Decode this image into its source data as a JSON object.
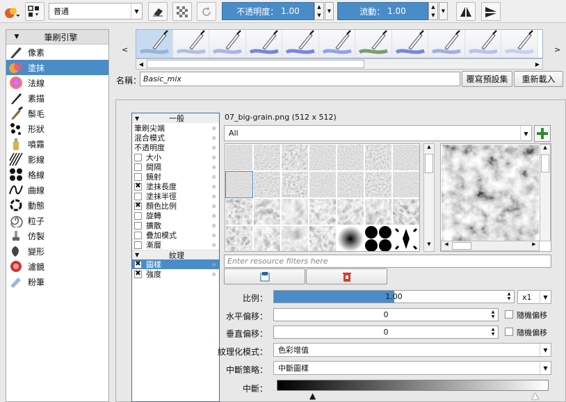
{
  "toolbar": {
    "blend_mode": "普通",
    "opacity_label": "不透明度：",
    "opacity_value": "1.00",
    "flow_label": "流動：",
    "flow_value": "1.00",
    "colors": {
      "accent": "#4a8cc8"
    }
  },
  "sidebar": {
    "header": "筆刷引擎",
    "items": [
      {
        "label": "像素",
        "icon": "pixel-brush-icon"
      },
      {
        "label": "塗抹",
        "icon": "smudge-brush-icon",
        "selected": true
      },
      {
        "label": "法線",
        "icon": "normal-sphere-icon"
      },
      {
        "label": "素描",
        "icon": "sketch-pen-icon"
      },
      {
        "label": "鬃毛",
        "icon": "bristle-brush-icon"
      },
      {
        "label": "形狀",
        "icon": "shape-dots-icon"
      },
      {
        "label": "噴霧",
        "icon": "spray-can-icon"
      },
      {
        "label": "影線",
        "icon": "hatching-icon"
      },
      {
        "label": "格線",
        "icon": "grid-dots-icon"
      },
      {
        "label": "曲線",
        "icon": "curve-icon"
      },
      {
        "label": "動態",
        "icon": "dynamic-circle-icon"
      },
      {
        "label": "粒子",
        "icon": "particle-spiral-icon"
      },
      {
        "label": "仿製",
        "icon": "clone-stamp-icon"
      },
      {
        "label": "變形",
        "icon": "deform-icon"
      },
      {
        "label": "濾鏡",
        "icon": "filter-icon"
      },
      {
        "label": "粉筆",
        "icon": "chalk-icon"
      }
    ]
  },
  "preset_bar": {
    "left_arrow": "<",
    "right_arrow": ">"
  },
  "name_row": {
    "label": "名稱：",
    "value": "Basic_mix",
    "overwrite_button": "覆寫預設集",
    "reload_button": "重新載入"
  },
  "options": {
    "general_header": "一般",
    "rows": [
      {
        "label": "筆刷尖端",
        "checkbox": false
      },
      {
        "label": "混合模式",
        "checkbox": false
      },
      {
        "label": "不透明度",
        "checkbox": false
      },
      {
        "label": "大小",
        "checkbox": true,
        "checked": false
      },
      {
        "label": "間隔",
        "checkbox": true,
        "checked": false
      },
      {
        "label": "鏡射",
        "checkbox": true,
        "checked": false
      },
      {
        "label": "塗抹長度",
        "checkbox": true,
        "checked": true
      },
      {
        "label": "塗抹半徑",
        "checkbox": true,
        "checked": false
      },
      {
        "label": "顏色比例",
        "checkbox": true,
        "checked": true
      },
      {
        "label": "旋轉",
        "checkbox": true,
        "checked": false
      },
      {
        "label": "擴散",
        "checkbox": true,
        "checked": false
      },
      {
        "label": "疊加模式",
        "checkbox": true,
        "checked": false
      },
      {
        "label": "漸層",
        "checkbox": true,
        "checked": false
      }
    ],
    "texture_header": "紋理",
    "texture_rows": [
      {
        "label": "圖樣",
        "checked": true,
        "selected": true
      },
      {
        "label": "強度",
        "checked": true
      }
    ]
  },
  "texture": {
    "file_info": "07_big-grain.png (512 x 512)",
    "filter_value": "All",
    "filter_placeholder": "Enter resource filters here",
    "scale_label": "比例：",
    "scale_value": "1.00",
    "scale_fraction": 0.5,
    "scale_multiplier": "x1",
    "h_offset_label": "水平偏移：",
    "h_offset_value": "0",
    "v_offset_label": "垂直偏移：",
    "v_offset_value": "0",
    "random_offset_label": "隨機偏移",
    "texturing_mode_label": "紋理化模式：",
    "texturing_mode_value": "色彩增值",
    "cutoff_policy_label": "中斷策略：",
    "cutoff_policy_value": "中斷圖樣",
    "cutoff_label": "中斷："
  }
}
